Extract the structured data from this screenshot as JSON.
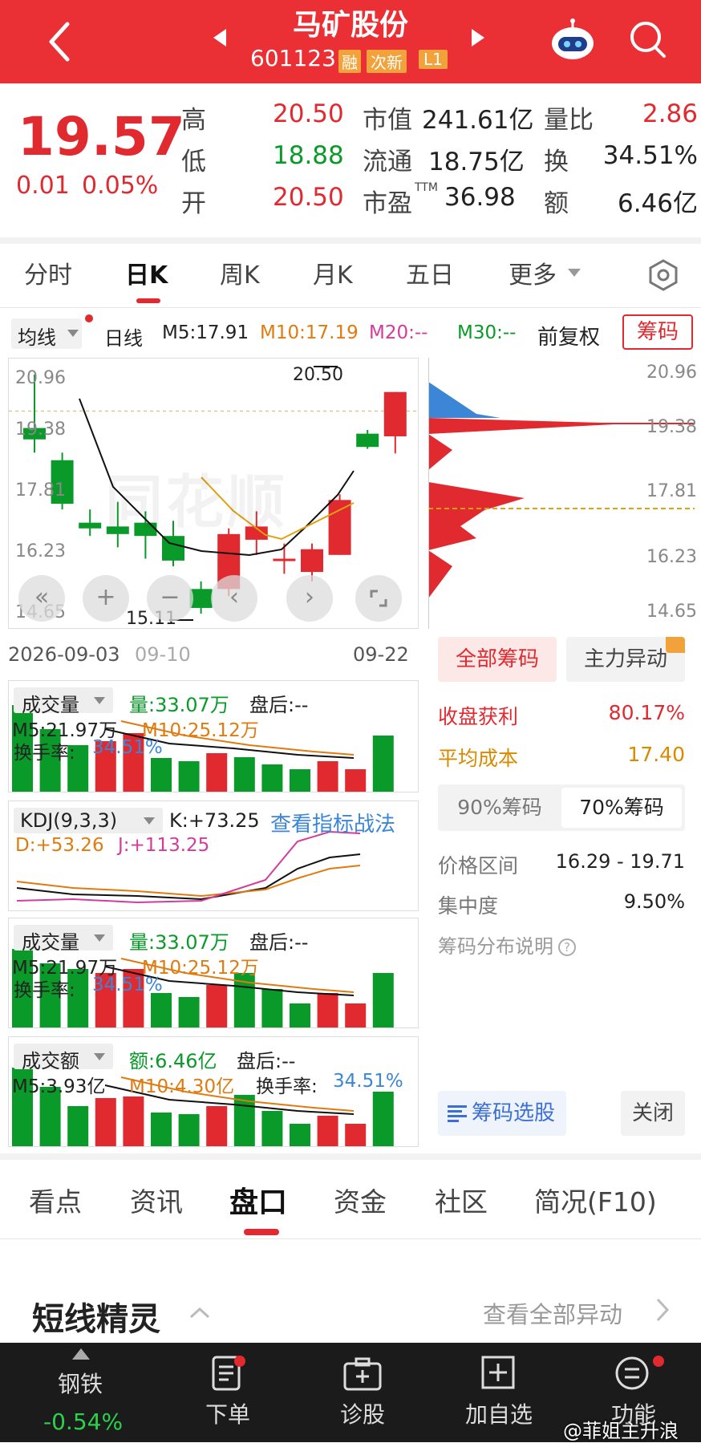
{
  "header": {
    "title": "马矿股份",
    "code": "601123",
    "badges": [
      "融",
      "次新",
      "L1"
    ]
  },
  "quote": {
    "price": "19.57",
    "change": "0.01",
    "change_pct": "0.05%",
    "rows": [
      {
        "l1": "高",
        "v1": "20.50",
        "l2": "市值",
        "v2": "241.61亿",
        "l3": "量比",
        "v3": "2.86"
      },
      {
        "l1": "低",
        "v1": "18.88",
        "l2": "流通",
        "v2": "18.75亿",
        "l3": "换",
        "v3": "34.51%"
      },
      {
        "l1": "开",
        "v1": "20.50",
        "l2": "市盈",
        "l2sup": "TTM",
        "v2": "36.98",
        "l3": "额",
        "v3": "6.46亿"
      }
    ]
  },
  "tabs": [
    "分时",
    "日K",
    "周K",
    "月K",
    "五日",
    "更多"
  ],
  "ma_bar": {
    "selector": "均线",
    "period": "日线",
    "m5": "M5:17.91",
    "m10": "M10:17.19",
    "m20": "M20:--",
    "m30": "M30:--",
    "adjust": "前复权",
    "chip_btn": "筹码"
  },
  "kline": {
    "axis": [
      "20.96",
      "19.38",
      "17.81",
      "16.23",
      "14.65"
    ],
    "high_label": "20.50",
    "low_label": "15.11",
    "date_start": "2026-09-03",
    "date_mid": "09-10",
    "date_end": "09-22",
    "watermark": "同花顺"
  },
  "chip_axis": [
    "20.96",
    "19.38",
    "17.81",
    "16.23",
    "14.65"
  ],
  "chip_panel": {
    "tab_all": "全部筹码",
    "tab_main": "主力异动",
    "profit_label": "收盘获利",
    "profit": "80.17%",
    "avg_label": "平均成本",
    "avg": "17.40",
    "tab90": "90%筹码",
    "tab70": "70%筹码",
    "range_label": "价格区间",
    "range": "16.29 - 19.71",
    "conc_label": "集中度",
    "conc": "9.50%",
    "explain": "筹码分布说明",
    "select_btn": "筹码选股",
    "close_btn": "关闭"
  },
  "vol1": {
    "sel": "成交量",
    "amt": "量:33.07万",
    "after": "盘后:--",
    "m5": "M5:21.97万",
    "m10": "M10:25.12万",
    "tr_label": "换手率:",
    "tr": "34.51%"
  },
  "kdj": {
    "sel": "KDJ(9,3,3)",
    "k": "K:+73.25",
    "link": "查看指标战法",
    "d": "D:+53.26",
    "j": "J:+113.25"
  },
  "vol2": {
    "sel": "成交量",
    "amt": "量:33.07万",
    "after": "盘后:--",
    "m5": "M5:21.97万",
    "m10": "M10:25.12万",
    "tr_label": "换手率:",
    "tr": "34.51%"
  },
  "amount": {
    "sel": "成交额",
    "amt": "额:6.46亿",
    "after": "盘后:--",
    "m5": "M5:3.93亿",
    "m10": "M10:4.30亿",
    "tr_label": "换手率:",
    "tr": "34.51%"
  },
  "bottom_tabs": [
    "看点",
    "资讯",
    "盘口",
    "资金",
    "社区",
    "简况(F10)"
  ],
  "spirit": {
    "title": "短线精灵",
    "link": "查看全部异动"
  },
  "bottombar": {
    "sector": "钢铁",
    "sector_chg": "-0.54%",
    "items": [
      "下单",
      "诊股",
      "加自选",
      "功能"
    ],
    "watermark": "@菲姐主升浪"
  },
  "colors": {
    "brand": "#ea2f35",
    "up": "#e02a2f",
    "down": "#0a9a2a"
  }
}
